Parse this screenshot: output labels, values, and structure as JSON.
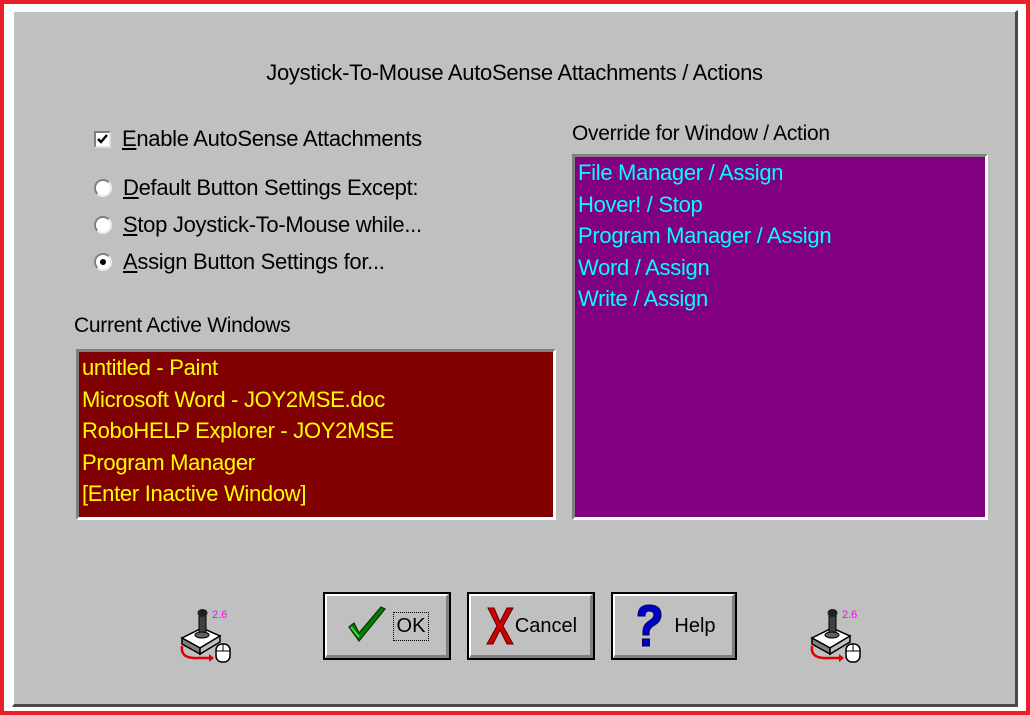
{
  "dialog": {
    "title": "Joystick-To-Mouse AutoSense Attachments / Actions"
  },
  "options": {
    "enable_autosense": {
      "label": "Enable AutoSense Attachments",
      "checked": true
    },
    "radios": [
      {
        "label": "Default Button Settings Except:",
        "selected": false
      },
      {
        "label": "Stop Joystick-To-Mouse while...",
        "selected": false
      },
      {
        "label": "Assign Button Settings for...",
        "selected": true
      }
    ]
  },
  "current_windows": {
    "label": "Current Active Windows",
    "items": [
      "untitled - Paint",
      "Microsoft Word - JOY2MSE.doc",
      "RoboHELP Explorer - JOY2MSE",
      "Program Manager",
      "[Enter Inactive Window]"
    ]
  },
  "override": {
    "label": "Override for Window / Action",
    "items": [
      "File Manager / Assign",
      "Hover! / Stop",
      "Program Manager / Assign",
      "Word / Assign",
      "Write / Assign"
    ]
  },
  "buttons": {
    "ok": "OK",
    "cancel": "Cancel",
    "help": "Help"
  },
  "icons": {
    "version_badge": "2.6",
    "left_icon": "joystick-mouse-icon",
    "right_icon": "joystick-mouse-icon"
  },
  "colors": {
    "current_list_bg": "#800000",
    "current_list_text": "#ffff00",
    "override_list_bg": "#800080",
    "override_list_text": "#00ffff",
    "frame_border": "#e8202a",
    "dialog_bg": "#c0c0c0"
  }
}
